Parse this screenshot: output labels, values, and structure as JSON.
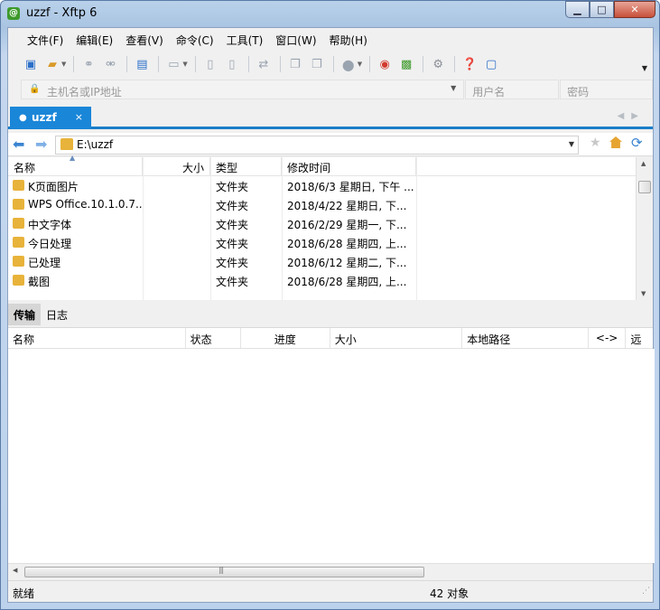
{
  "window": {
    "title": "uzzf - Xftp 6",
    "app_icon": "xftp-icon"
  },
  "menu": [
    "文件(F)",
    "编辑(E)",
    "查看(V)",
    "命令(C)",
    "工具(T)",
    "窗口(W)",
    "帮助(H)"
  ],
  "connect": {
    "host_placeholder": "主机名或IP地址",
    "user_placeholder": "用户名",
    "password_placeholder": "密码"
  },
  "session_tab": {
    "label": "uzzf",
    "close": "×"
  },
  "path": {
    "value": "E:\\uzzf"
  },
  "file_list": {
    "columns": [
      "名称",
      "大小",
      "类型",
      "修改时间"
    ],
    "rows": [
      {
        "name": "K页面图片",
        "size": "",
        "type": "文件夹",
        "mtime": "2018/6/3 星期日, 下午 ..."
      },
      {
        "name": "WPS Office.10.1.0.7...",
        "size": "",
        "type": "文件夹",
        "mtime": "2018/4/22 星期日, 下..."
      },
      {
        "name": "中文字体",
        "size": "",
        "type": "文件夹",
        "mtime": "2016/2/29 星期一, 下..."
      },
      {
        "name": "今日处理",
        "size": "",
        "type": "文件夹",
        "mtime": "2018/6/28 星期四, 上..."
      },
      {
        "name": "已处理",
        "size": "",
        "type": "文件夹",
        "mtime": "2018/6/12 星期二, 下..."
      },
      {
        "name": "截图",
        "size": "",
        "type": "文件夹",
        "mtime": "2018/6/28 星期四, 上..."
      }
    ]
  },
  "bottom_tabs": [
    "传输",
    "日志"
  ],
  "transfer_columns": [
    "名称",
    "状态",
    "进度",
    "大小",
    "本地路径",
    "<->",
    "远"
  ],
  "status": {
    "left": "就绪",
    "count": "42 对象"
  },
  "colors": {
    "accent": "#1a86d8",
    "folder": "#e8b33a"
  }
}
